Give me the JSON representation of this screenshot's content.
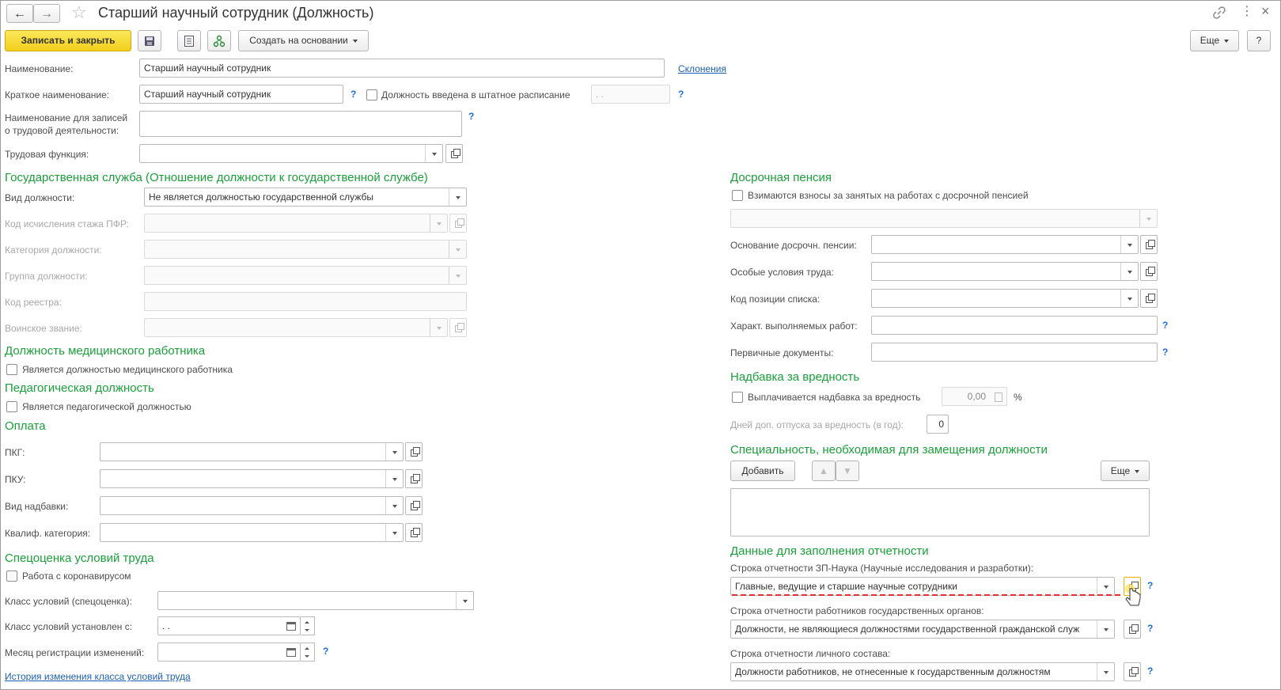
{
  "window": {
    "title": "Старший научный сотрудник (Должность)"
  },
  "toolbar": {
    "save_close": "Записать и закрыть",
    "create_based": "Создать на основании",
    "more": "Еще",
    "help": "?"
  },
  "main": {
    "name_label": "Наименование:",
    "name_value": "Старший научный сотрудник",
    "declensions_link": "Склонения",
    "short_name_label": "Краткое наименование:",
    "short_name_value": "Старший научный сотрудник",
    "staff_schedule_label": "Должность введена в штатное расписание",
    "staff_schedule_date": " .  .",
    "labor_record_label_1": "Наименование для записей",
    "labor_record_label_2": "о трудовой деятельности:",
    "labor_function_label": "Трудовая функция:"
  },
  "civil_service": {
    "title": "Государственная служба (Отношение должности к государственной службе)",
    "position_kind_label": "Вид должности:",
    "position_kind_value": "Не является должностью государственной службы",
    "pfr_code_label": "Код исчисления стажа ПФР:",
    "category_label": "Категория должности:",
    "group_label": "Группа должности:",
    "registry_code_label": "Код реестра:",
    "military_rank_label": "Воинское звание:"
  },
  "medical": {
    "title": "Должность медицинского работника",
    "checkbox_label": "Является должностью медицинского работника"
  },
  "pedagogical": {
    "title": "Педагогическая должность",
    "checkbox_label": "Является педагогической должностью"
  },
  "payment": {
    "title": "Оплата",
    "pkg_label": "ПКГ:",
    "pku_label": "ПКУ:",
    "allowance_label": "Вид надбавки:",
    "qualification_label": "Квалиф. категория:"
  },
  "special_assessment": {
    "title": "Спецоценка условий труда",
    "corona_label": "Работа с коронавирусом",
    "class_label": "Класс условий (спецоценка):",
    "class_set_label": "Класс условий установлен с:",
    "class_set_value": " .  .",
    "month_label": "Месяц регистрации изменений:",
    "history_link": "История изменения класса условий труда"
  },
  "early_pension": {
    "title": "Досрочная пенсия",
    "checkbox_label": "Взимаются взносы за занятых на работах с досрочной пенсией",
    "basis_label": "Основание досрочн. пенсии:",
    "conditions_label": "Особые условия труда:",
    "list_code_label": "Код позиции списка:",
    "work_char_label": "Характ. выполняемых работ:",
    "primary_docs_label": "Первичные документы:"
  },
  "hazard": {
    "title": "Надбавка за вредность",
    "checkbox_label": "Выплачивается надбавка за вредность",
    "amount": "0,00",
    "percent": "%",
    "vacation_label": "Дней доп. отпуска за вредность (в год):",
    "vacation_value": "0"
  },
  "specialty": {
    "title": "Специальность, необходимая для замещения должности",
    "add_button": "Добавить",
    "more_button": "Еще"
  },
  "reporting": {
    "title": "Данные для заполнения отчетности",
    "zp_science_label": "Строка отчетности ЗП-Наука (Научные исследования и разработки):",
    "zp_science_value": "Главные, ведущие и старшие научные сотрудники",
    "gov_bodies_label": "Строка отчетности работников государственных органов:",
    "gov_bodies_value": "Должности, не являющиеся должностями государственной гражданской служ",
    "personnel_label": "Строка отчетности личного состава:",
    "personnel_value": "Должности работников, не отнесенные к государственным должностям"
  },
  "help_mark": "?"
}
